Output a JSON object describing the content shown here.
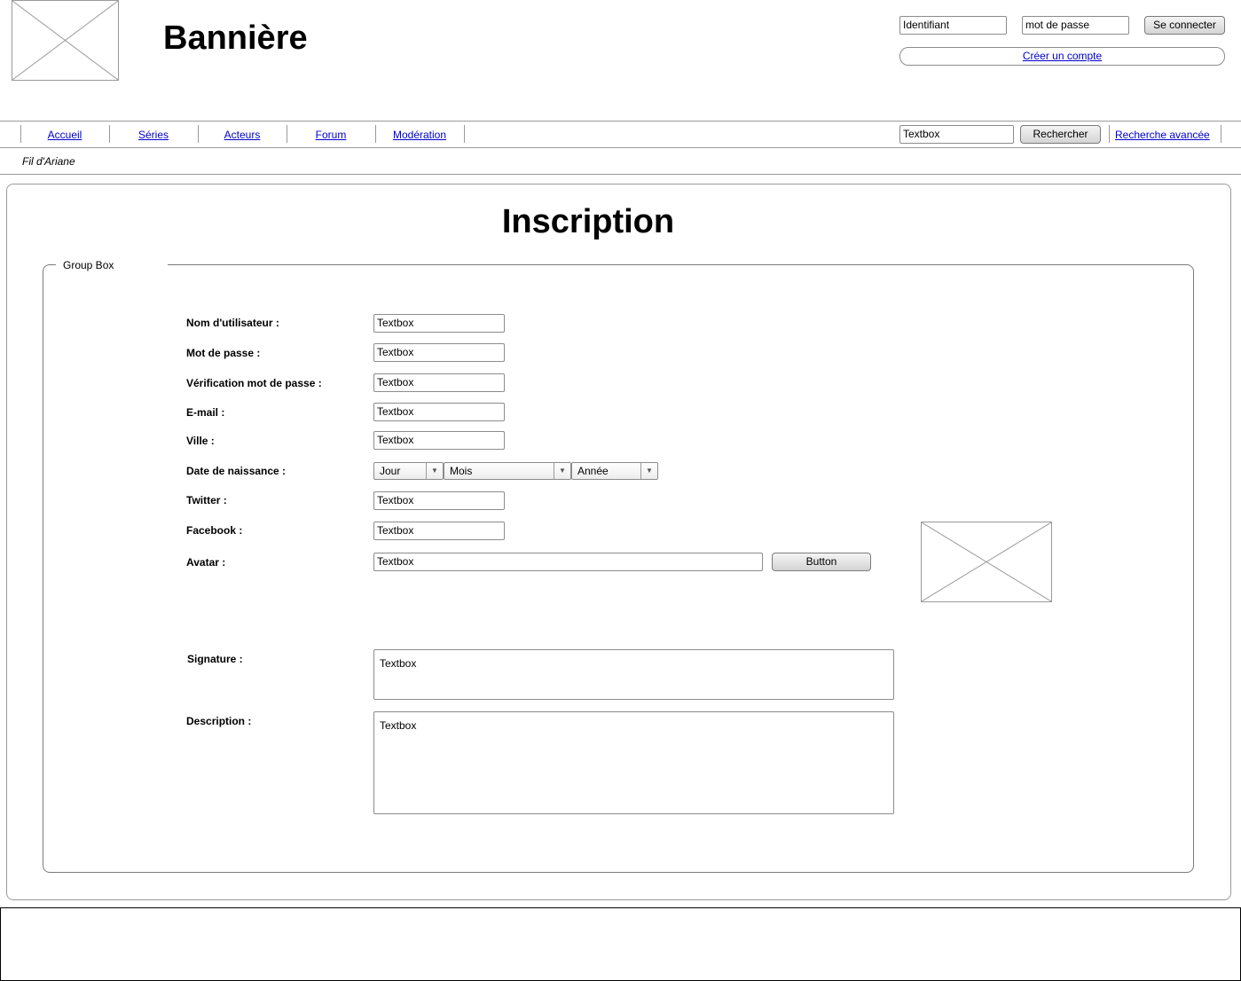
{
  "header": {
    "banner_title": "Bannière",
    "login": {
      "username_value": "Identifiant",
      "password_value": "mot de passe",
      "login_button": "Se connecter",
      "create_account_link": "Créer un compte"
    }
  },
  "nav": {
    "items": [
      {
        "label": "Accueil"
      },
      {
        "label": "Séries"
      },
      {
        "label": "Acteurs"
      },
      {
        "label": "Forum"
      },
      {
        "label": "Modération"
      }
    ],
    "search_value": "Textbox",
    "search_button": "Rechercher",
    "advanced_search_link": "Recherche avancée"
  },
  "breadcrumb": "Fil d'Ariane",
  "main": {
    "title": "Inscription",
    "group_box_label": "Group Box",
    "fields": {
      "username": {
        "label": "Nom d'utilisateur :",
        "value": "Textbox"
      },
      "password": {
        "label": "Mot de passe :",
        "value": "Textbox"
      },
      "password_check": {
        "label": "Vérification mot de passe :",
        "value": "Textbox"
      },
      "email": {
        "label": "E-mail :",
        "value": "Textbox"
      },
      "city": {
        "label": "Ville :",
        "value": "Textbox"
      },
      "birthdate": {
        "label": "Date de naissance :",
        "day": "Jour",
        "month": "Mois",
        "year": "Année"
      },
      "twitter": {
        "label": "Twitter :",
        "value": "Textbox"
      },
      "facebook": {
        "label": "Facebook :",
        "value": "Textbox"
      },
      "avatar": {
        "label": "Avatar :",
        "value": "Textbox",
        "button": "Button"
      },
      "signature": {
        "label": "Signature :",
        "value": "Textbox"
      },
      "description": {
        "label": "Description :",
        "value": "Textbox"
      }
    }
  },
  "icons": {
    "image_placeholder": "image-placeholder-icon",
    "dropdown_arrow": "chevron-down-icon"
  }
}
